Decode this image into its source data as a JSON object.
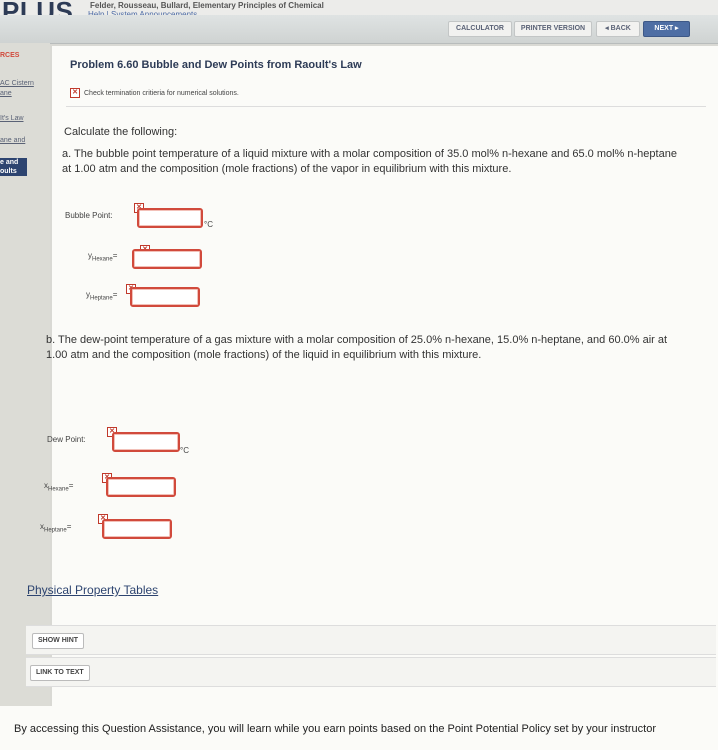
{
  "header": {
    "logo": "PLUS",
    "course": "Felder, Rousseau, Bullard, Elementary Principles of Chemical",
    "help_links": "Help | System Announcements"
  },
  "nav": {
    "calculator": "CALCULATOR",
    "printer": "PRINTER VERSION",
    "back": "◂ BACK",
    "next": "NEXT ▸"
  },
  "sidebar": {
    "items": [
      "RCES",
      "AC Cistern",
      "ane",
      "It's Law",
      "ane and",
      "e and",
      "oults"
    ]
  },
  "problem": {
    "title": "Problem 6.60 Bubble and Dew Points from Raoult's Law",
    "warning": "Check termination critieria for numerical solutions.",
    "intro": "Calculate the following:",
    "part_a": "a. The bubble point temperature of a liquid mixture with a molar composition of 35.0 mol% n-hexane and 65.0 mol% n-heptane at 1.00 atm and the composition (mole fractions) of the vapor in equilibrium with this mixture.",
    "part_b": "b. The dew-point temperature of a gas mixture with a molar composition of 25.0% n-hexane, 15.0% n-heptane, and 60.0% air at 1.00 atm and the composition (mole fractions) of the liquid in equilibrium with this mixture.",
    "bubble_label": "Bubble Point:",
    "y_hexane_base": "y",
    "y_hexane_sub": "Hexane",
    "y_heptane_base": "y",
    "y_heptane_sub": "Heptane",
    "dew_label": "Dew Point:",
    "x_hexane_base": "x",
    "x_hexane_sub": "Hexane",
    "x_heptane_base": "x",
    "x_heptane_sub": "Heptane",
    "unit_c": "°C",
    "suffix": "="
  },
  "links": {
    "property_tables": "Physical Property Tables",
    "show_hint": "SHOW HINT",
    "link_to_text": "LINK TO TEXT"
  },
  "footer": {
    "text": "By accessing this Question Assistance, you will learn while you earn points based on the Point Potential Policy set by your instructor"
  },
  "colors": {
    "accent": "#4e6ea4",
    "error": "#d14a3c",
    "title": "#2d3b56"
  }
}
